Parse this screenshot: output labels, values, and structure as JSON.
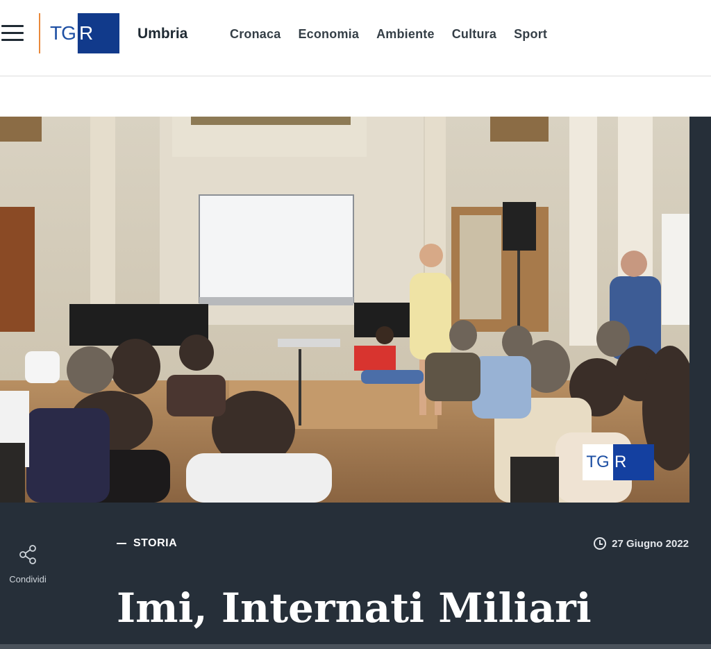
{
  "header": {
    "logo": {
      "left_text": "TG",
      "right_text": "R"
    },
    "region": "Umbria",
    "nav": [
      "Cronaca",
      "Economia",
      "Ambiente",
      "Cultura",
      "Sport"
    ]
  },
  "hero": {
    "watermark": {
      "left_text": "TG",
      "right_text": "R"
    }
  },
  "share": {
    "label": "Condividi",
    "icon": "share-icon"
  },
  "article": {
    "category": "STORIA",
    "date": "27 Giugno 2022",
    "title": "Imi, Internati Miliari"
  },
  "colors": {
    "dark_band": "#262f39",
    "logo_blue": "#113a8b",
    "accent_orange": "#e9893b"
  }
}
